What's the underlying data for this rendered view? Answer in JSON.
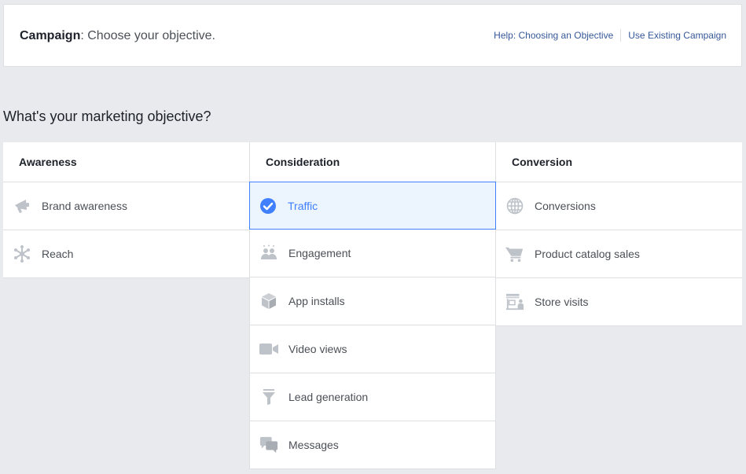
{
  "header": {
    "title_bold": "Campaign",
    "title_rest": ": Choose your objective.",
    "help_link": "Help: Choosing an Objective",
    "existing_link": "Use Existing Campaign"
  },
  "question": "What's your marketing objective?",
  "columns": [
    {
      "title": "Awareness",
      "items": [
        {
          "label": "Brand awareness",
          "icon": "megaphone-icon"
        },
        {
          "label": "Reach",
          "icon": "reach-icon"
        }
      ]
    },
    {
      "title": "Consideration",
      "items": [
        {
          "label": "Traffic",
          "icon": "check-circle-icon",
          "selected": true
        },
        {
          "label": "Engagement",
          "icon": "people-icon"
        },
        {
          "label": "App installs",
          "icon": "box-icon"
        },
        {
          "label": "Video views",
          "icon": "video-camera-icon"
        },
        {
          "label": "Lead generation",
          "icon": "funnel-icon"
        },
        {
          "label": "Messages",
          "icon": "chat-bubbles-icon"
        }
      ]
    },
    {
      "title": "Conversion",
      "items": [
        {
          "label": "Conversions",
          "icon": "globe-icon"
        },
        {
          "label": "Product catalog sales",
          "icon": "cart-icon"
        },
        {
          "label": "Store visits",
          "icon": "store-icon"
        }
      ]
    }
  ],
  "colors": {
    "accent": "#4080ff",
    "selected_bg": "#ecf4fd",
    "icon_gray": "#bec3c9",
    "link": "#365899"
  }
}
